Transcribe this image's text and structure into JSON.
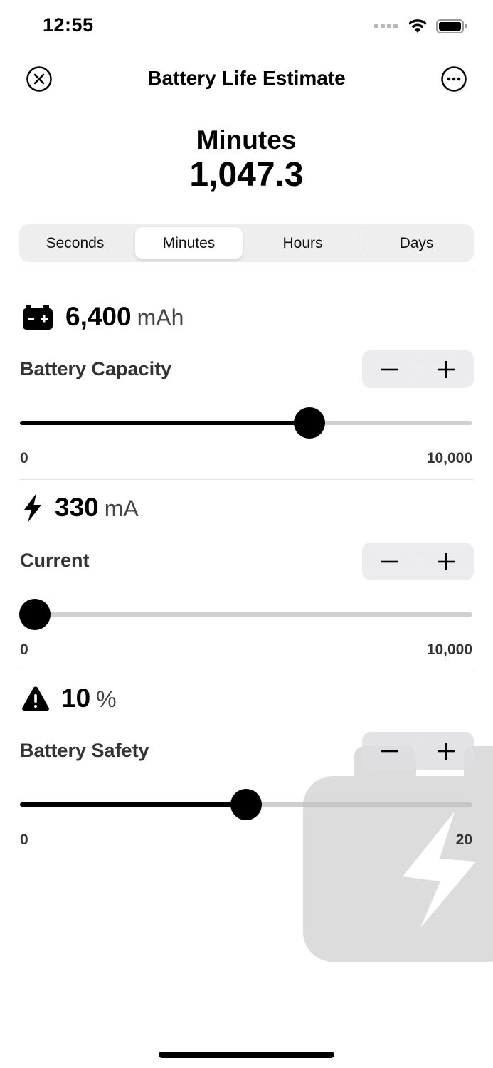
{
  "status_bar": {
    "time": "12:55"
  },
  "nav": {
    "title": "Battery Life Estimate"
  },
  "result": {
    "unit": "Minutes",
    "value": "1,047.3"
  },
  "segments": [
    {
      "label": "Seconds"
    },
    {
      "label": "Minutes"
    },
    {
      "label": "Hours"
    },
    {
      "label": "Days"
    }
  ],
  "selected_segment": "Minutes",
  "capacity": {
    "value": "6,400",
    "unit": "mAh",
    "label": "Battery Capacity",
    "min": "0",
    "max": "10,000",
    "slider_value": 6400
  },
  "current": {
    "value": "330",
    "unit": "mA",
    "label": "Current",
    "min": "0",
    "max": "10,000",
    "slider_value": 330
  },
  "safety": {
    "value": "10",
    "unit": "%",
    "label": "Battery Safety",
    "min": "0",
    "max": "20",
    "slider_value": 10
  },
  "colors": {
    "accent": "#000000",
    "track": "#d0d0d3",
    "segment_bg": "#eeeeef",
    "watermark": "#dcdcdc"
  }
}
